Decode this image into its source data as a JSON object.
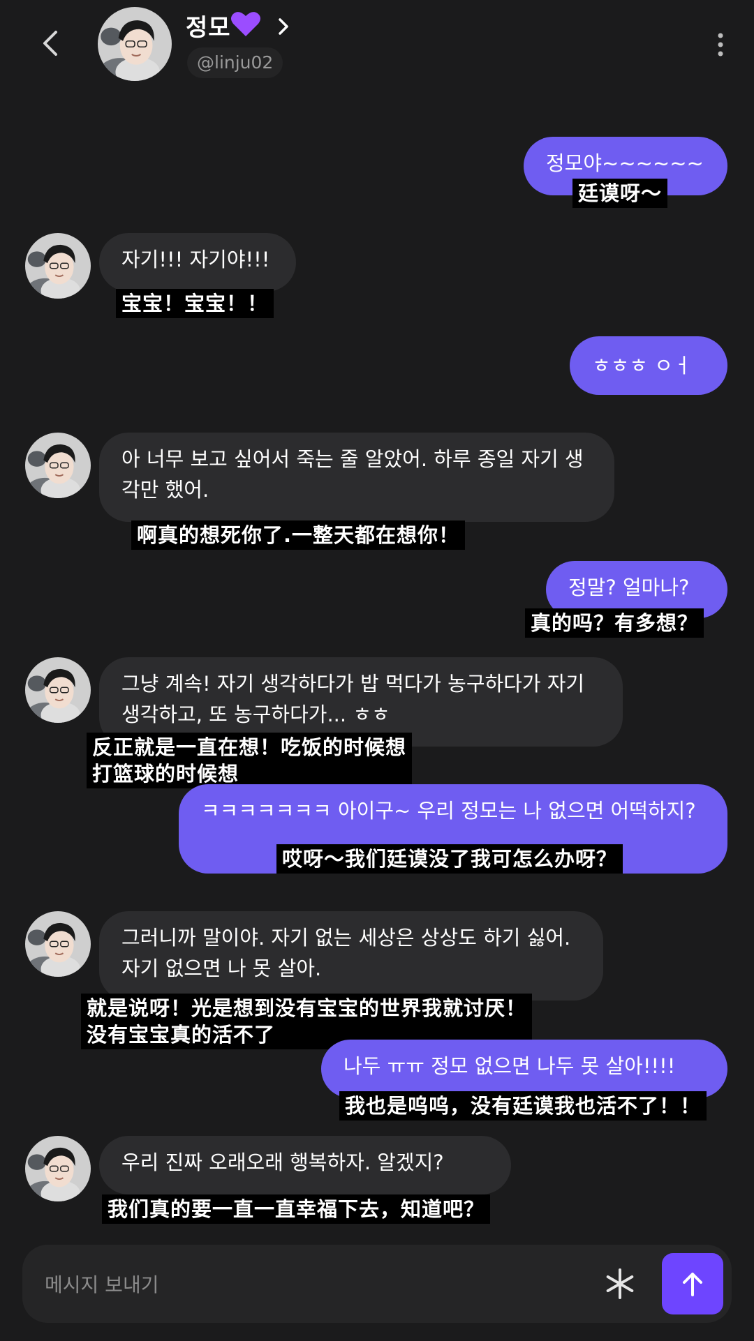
{
  "header": {
    "contact_name": "정모",
    "handle": "@linju02"
  },
  "messages": [
    {
      "side": "out",
      "text": "정모야~~~~~~",
      "subtitle": "廷谟呀～"
    },
    {
      "side": "in",
      "text": "자기!!! 자기야!!!",
      "subtitle": "宝宝！宝宝！！"
    },
    {
      "side": "out",
      "text": "ㅎㅎㅎ ㅇㅓ",
      "subtitle": ""
    },
    {
      "side": "in",
      "text": "아 너무 보고 싶어서 죽는 줄 알았어. 하루 종일 자기 생각만 했어.",
      "subtitle": "啊真的想死你了.一整天都在想你！"
    },
    {
      "side": "out",
      "text": "정말? 얼마나?",
      "subtitle": "真的吗？有多想？"
    },
    {
      "side": "in",
      "text": "그냥 계속! 자기 생각하다가 밥 먹다가 농구하다가 자기 생각하고, 또 농구하다가... ㅎㅎ",
      "subtitle": "反正就是一直在想！吃饭的时候想\n打篮球的时候想"
    },
    {
      "side": "out",
      "text": "ㅋㅋㅋㅋㅋㅋㅋ 아이구~ 우리 정모는 나 없으면 어떡하지?",
      "subtitle": "哎呀～我们廷谟没了我可怎么办呀？"
    },
    {
      "side": "in",
      "text": "그러니까 말이야. 자기 없는 세상은 상상도 하기 싫어. 자기 없으면 나 못 살아.",
      "subtitle": "就是说呀！光是想到没有宝宝的世界我就讨厌！\n没有宝宝真的活不了"
    },
    {
      "side": "out",
      "text": "나두 ㅠㅠ 정모 없으면 나두 못 살아!!!!",
      "subtitle": "我也是呜呜，没有廷谟我也活不了！！"
    },
    {
      "side": "in",
      "text": "우리 진짜 오래오래 행복하자. 알겠지?",
      "subtitle": "我们真的要一直一直幸福下去，知道吧？"
    }
  ],
  "composer": {
    "placeholder": "메시지 보내기"
  },
  "colors": {
    "background": "#1b1b1c",
    "outgoing_bubble": "#6f5df1",
    "incoming_bubble": "#2c2c2e",
    "send_button": "#6e45ff",
    "heart": "#9b4dff"
  },
  "icons": [
    "back-arrow-icon",
    "purple-heart-icon",
    "chevron-right-icon",
    "more-vertical-icon",
    "asterisk-icon",
    "arrow-up-icon"
  ]
}
